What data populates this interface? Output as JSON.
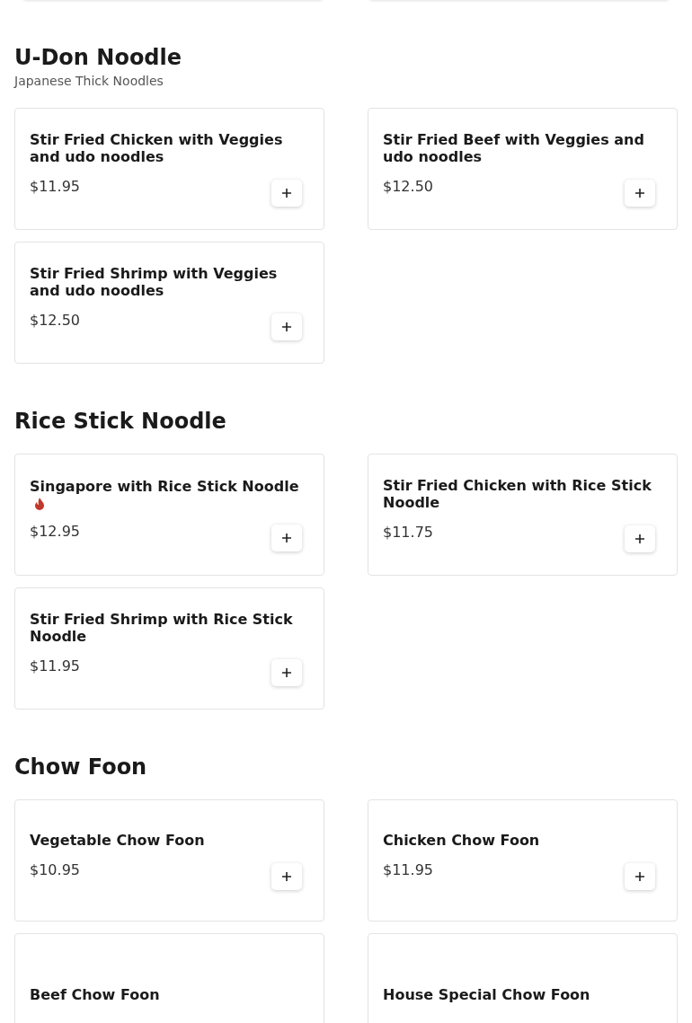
{
  "sections": [
    {
      "title": "U-Don Noodle",
      "subtitle": "Japanese Thick Noodles",
      "items": [
        {
          "name": "Stir Fried Chicken with Veggies and udo noodles",
          "spicy": false,
          "price": "$11.95"
        },
        {
          "name": "Stir Fried Beef with Veggies and udo noodles",
          "spicy": false,
          "price": "$12.50"
        },
        {
          "name": "Stir Fried Shrimp with Veggies and udo noodles",
          "spicy": false,
          "price": "$12.50"
        }
      ]
    },
    {
      "title": "Rice Stick Noodle",
      "items": [
        {
          "name": "Singapore with Rice Stick Noodle",
          "spicy": true,
          "price": "$12.95"
        },
        {
          "name": "Stir Fried Chicken with Rice Stick Noodle",
          "spicy": false,
          "price": "$11.75"
        },
        {
          "name": "Stir Fried Shrimp with Rice Stick Noodle",
          "spicy": false,
          "price": "$11.95"
        }
      ]
    },
    {
      "title": "Chow Foon",
      "items": [
        {
          "name": "Vegetable Chow Foon",
          "spicy": false,
          "price": "$10.95"
        },
        {
          "name": "Chicken Chow Foon",
          "spicy": false,
          "price": "$11.95"
        },
        {
          "name": "Beef Chow Foon",
          "spicy": false
        },
        {
          "name": "House Special Chow Foon",
          "spicy": false
        }
      ]
    }
  ]
}
